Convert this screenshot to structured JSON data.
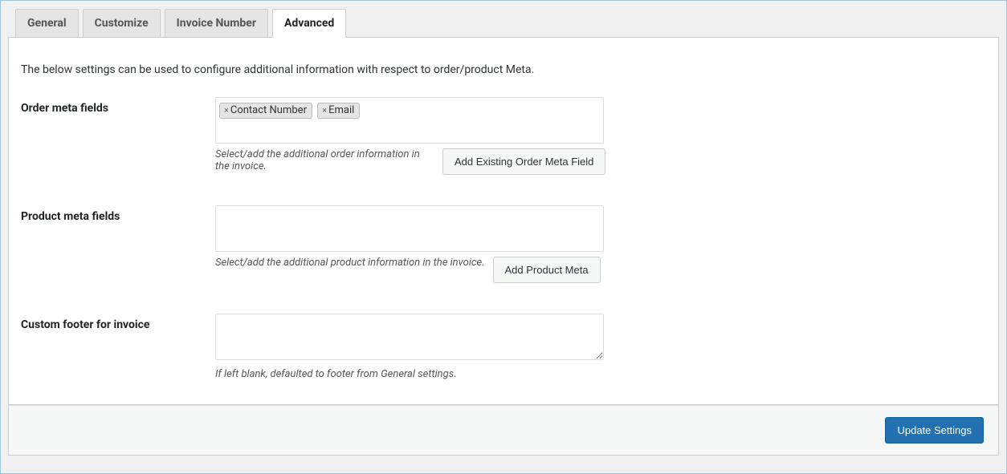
{
  "tabs": [
    {
      "label": "General",
      "active": false
    },
    {
      "label": "Customize",
      "active": false
    },
    {
      "label": "Invoice Number",
      "active": false
    },
    {
      "label": "Advanced",
      "active": true
    }
  ],
  "intro": "The below settings can be used to configure additional information with respect to order/product Meta.",
  "order_meta": {
    "label": "Order meta fields",
    "chips": [
      "Contact Number",
      "Email"
    ],
    "hint": "Select/add the additional order information in the invoice.",
    "button": "Add Existing Order Meta Field"
  },
  "product_meta": {
    "label": "Product meta fields",
    "chips": [],
    "hint": "Select/add the additional product information in the invoice.",
    "button": "Add Product Meta"
  },
  "custom_footer": {
    "label": "Custom footer for invoice",
    "value": "",
    "hint": "If left blank, defaulted to footer from General settings."
  },
  "submit_label": "Update Settings"
}
